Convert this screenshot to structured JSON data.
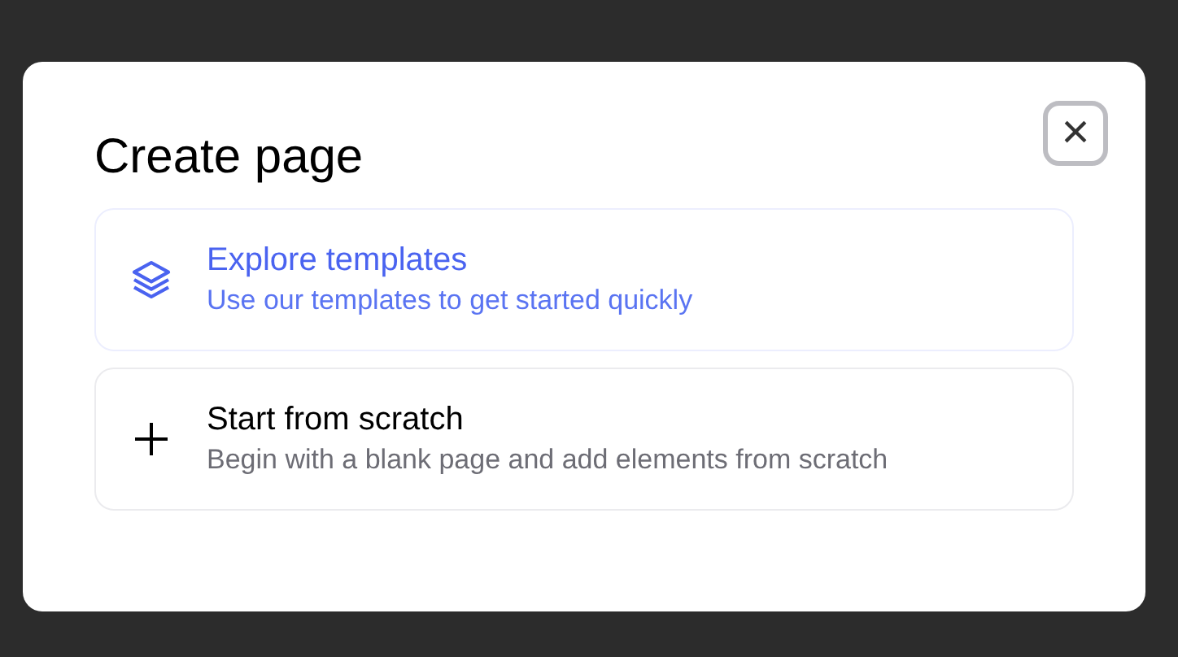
{
  "dialog": {
    "title": "Create page",
    "close_button": {
      "glyph": "×",
      "focused": true
    }
  },
  "options": [
    {
      "kind": "layers",
      "title": "Explore templates",
      "description": "Use our templates to get started quickly",
      "selected": true
    },
    {
      "kind": "plus",
      "title": "Start from scratch",
      "description": "Begin with a blank page and add elements from scratch",
      "selected": false
    }
  ]
}
